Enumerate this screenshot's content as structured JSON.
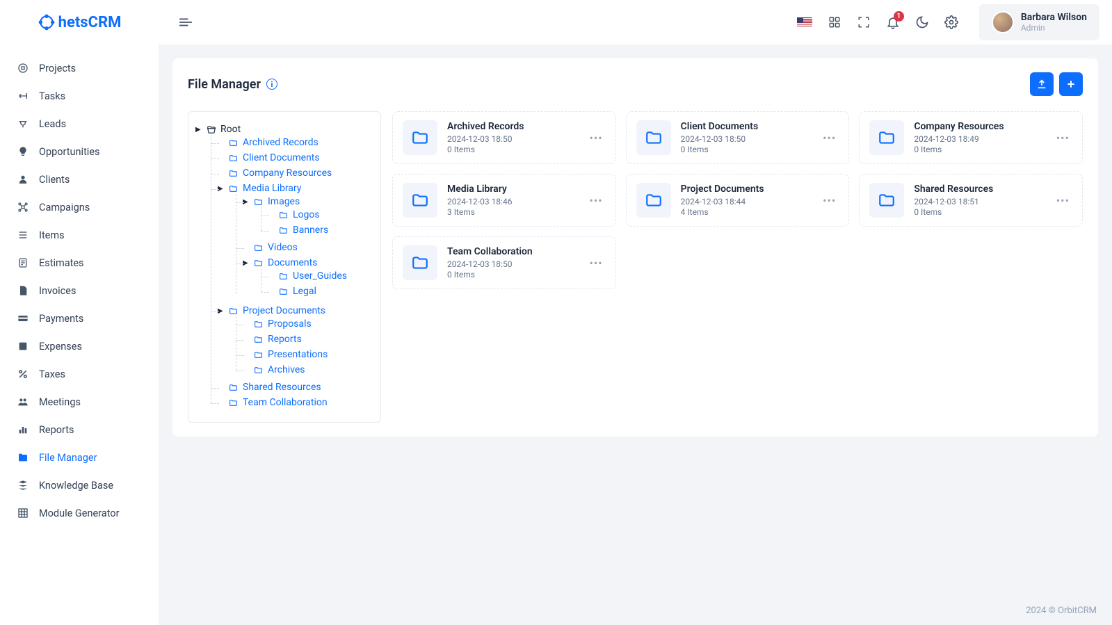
{
  "brand": "hetsCRM",
  "user": {
    "name": "Barbara Wilson",
    "role": "Admin"
  },
  "notification_count": "1",
  "sidebar": {
    "items": [
      {
        "label": "Projects"
      },
      {
        "label": "Tasks"
      },
      {
        "label": "Leads"
      },
      {
        "label": "Opportunities"
      },
      {
        "label": "Clients"
      },
      {
        "label": "Campaigns"
      },
      {
        "label": "Items"
      },
      {
        "label": "Estimates"
      },
      {
        "label": "Invoices"
      },
      {
        "label": "Payments"
      },
      {
        "label": "Expenses"
      },
      {
        "label": "Taxes"
      },
      {
        "label": "Meetings"
      },
      {
        "label": "Reports"
      },
      {
        "label": "File Manager"
      },
      {
        "label": "Knowledge Base"
      },
      {
        "label": "Module Generator"
      }
    ]
  },
  "page": {
    "title": "File Manager"
  },
  "tree": {
    "root": "Root",
    "nodes": {
      "archived": "Archived Records",
      "clientdocs": "Client Documents",
      "company": "Company Resources",
      "media": "Media Library",
      "images": "Images",
      "logos": "Logos",
      "banners": "Banners",
      "videos": "Videos",
      "documents": "Documents",
      "userguides": "User_Guides",
      "legal": "Legal",
      "projdocs": "Project Documents",
      "proposals": "Proposals",
      "reports": "Reports",
      "presentations": "Presentations",
      "archives": "Archives",
      "shared": "Shared Resources",
      "team": "Team Collaboration"
    }
  },
  "folders": [
    {
      "name": "Archived Records",
      "date": "2024-12-03 18:50",
      "count": "0 Items"
    },
    {
      "name": "Client Documents",
      "date": "2024-12-03 18:50",
      "count": "0 Items"
    },
    {
      "name": "Company Resources",
      "date": "2024-12-03 18:49",
      "count": "0 Items"
    },
    {
      "name": "Media Library",
      "date": "2024-12-03 18:46",
      "count": "3 Items"
    },
    {
      "name": "Project Documents",
      "date": "2024-12-03 18:44",
      "count": "4 Items"
    },
    {
      "name": "Shared Resources",
      "date": "2024-12-03 18:51",
      "count": "0 Items"
    },
    {
      "name": "Team Collaboration",
      "date": "2024-12-03 18:50",
      "count": "0 Items"
    }
  ],
  "footer": "2024 © OrbitCRM"
}
